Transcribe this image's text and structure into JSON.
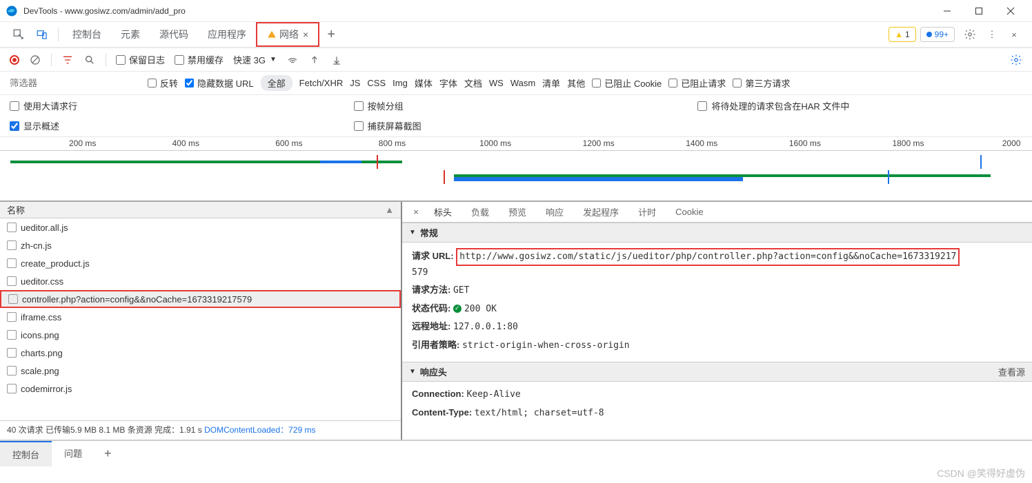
{
  "titlebar": {
    "title": "DevTools - www.gosiwz.com/admin/add_pro"
  },
  "toptabs": {
    "console": "控制台",
    "elements": "元素",
    "sources": "源代码",
    "application": "应用程序",
    "network": "网络",
    "warn_count": "1",
    "info_count": "99+"
  },
  "toolbar": {
    "preserve_log": "保留日志",
    "disable_cache": "禁用缓存",
    "throttle": "快速 3G"
  },
  "filter": {
    "placeholder": "筛选器",
    "invert": "反转",
    "hide_data": "隐藏数据 URL",
    "all": "全部",
    "types": [
      "Fetch/XHR",
      "JS",
      "CSS",
      "Img",
      "媒体",
      "字体",
      "文档",
      "WS",
      "Wasm",
      "清单",
      "其他"
    ],
    "blocked_cookie": "已阻止 Cookie",
    "blocked_req": "已阻止请求",
    "thirdparty": "第三方请求"
  },
  "opts": {
    "large_rows": "使用大请求行",
    "group_frame": "按帧分组",
    "include_har": "将待处理的请求包含在HAR 文件中",
    "show_overview": "显示概述",
    "capture": "捕获屏幕截图"
  },
  "timeline": {
    "ticks": [
      "200 ms",
      "400 ms",
      "600 ms",
      "800 ms",
      "1000 ms",
      "1200 ms",
      "1400 ms",
      "1600 ms",
      "1800 ms",
      "2000"
    ]
  },
  "requests": {
    "header": "名称",
    "items": [
      "ueditor.all.js",
      "zh-cn.js",
      "create_product.js",
      "ueditor.css",
      "controller.php?action=config&&noCache=1673319217579",
      "iframe.css",
      "icons.png",
      "charts.png",
      "scale.png",
      "codemirror.js"
    ],
    "status": "40 次请求  已传输5.9 MB  8.1 MB 条资源  完成：1.91 s  ",
    "status_dcl": "DOMContentLoaded：729 ms"
  },
  "detail": {
    "tabs": [
      "标头",
      "负载",
      "预览",
      "响应",
      "发起程序",
      "计时",
      "Cookie"
    ],
    "general": "常规",
    "url_label": "请求 URL:",
    "url_box": "http://www.gosiwz.com/static/js/ueditor/php/controller.php?action=config&&noCache=1673319217",
    "url_tail": "579",
    "method_label": "请求方法:",
    "method": "GET",
    "status_label": "状态代码:",
    "status": "200 OK",
    "remote_label": "远程地址:",
    "remote": "127.0.0.1:80",
    "referrer_label": "引用者策略:",
    "referrer": "strict-origin-when-cross-origin",
    "resp_hdr": "响应头",
    "view_src": "查看源",
    "conn_label": "Connection:",
    "conn": "Keep-Alive",
    "ct_label": "Content-Type:",
    "ct": "text/html; charset=utf-8"
  },
  "drawer": {
    "console": "控制台",
    "issues": "问题"
  },
  "watermark": "CSDN @笑得好虚伪"
}
